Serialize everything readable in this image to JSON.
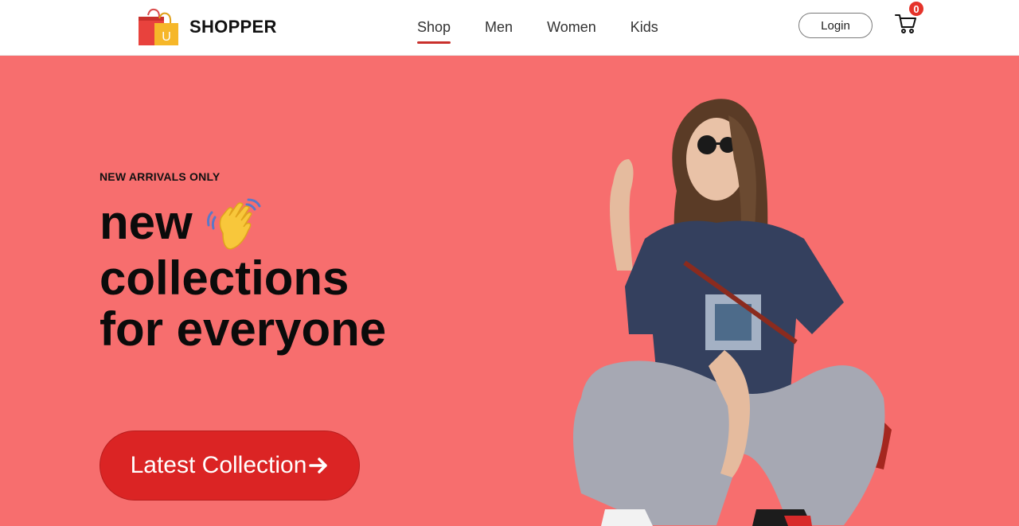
{
  "brand": {
    "name": "SHOPPER",
    "logo_letter": "U"
  },
  "nav": {
    "items": [
      {
        "label": "Shop",
        "active": true
      },
      {
        "label": "Men",
        "active": false
      },
      {
        "label": "Women",
        "active": false
      },
      {
        "label": "Kids",
        "active": false
      }
    ],
    "login_label": "Login",
    "cart_count": "0"
  },
  "hero": {
    "eyebrow": "NEW ARRIVALS ONLY",
    "headline_line1": "new",
    "headline_line2": "collections",
    "headline_line3": "for everyone",
    "cta_label": "Latest Collection",
    "icons": [
      "waving-hand-icon",
      "arrow-right-icon",
      "cart-icon",
      "shopping-bag-logo"
    ]
  },
  "colors": {
    "hero_bg": "#f76e6e",
    "cta_bg": "#db2424",
    "active_underline": "#c9302c",
    "badge": "#e5332a"
  }
}
